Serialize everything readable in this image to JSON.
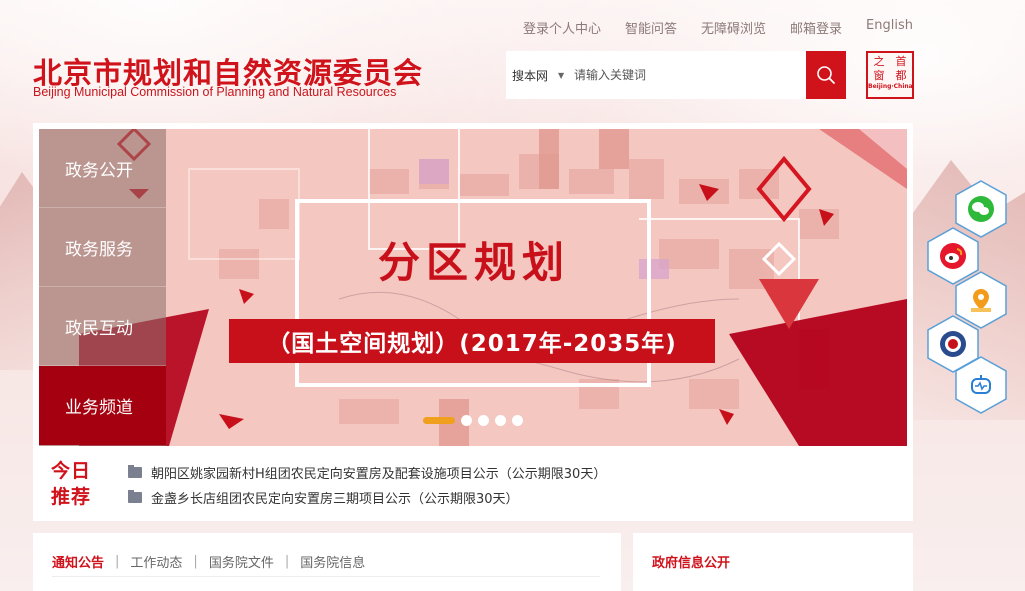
{
  "top_links": [
    "登录个人中心",
    "智能问答",
    "无障碍浏览",
    "邮箱登录",
    "English"
  ],
  "logo": {
    "cn": "北京市规划和自然资源委员会",
    "en": "Beijing Municipal Commission of Planning and Natural Resources"
  },
  "search": {
    "scope": "搜本网",
    "placeholder": "请输入关键词"
  },
  "seal": {
    "chars": [
      "首",
      "都",
      "之",
      "窗"
    ],
    "en": "Beijing·China"
  },
  "nav": {
    "items": [
      {
        "label": "政务公开"
      },
      {
        "label": "政务服务"
      },
      {
        "label": "政民互动"
      },
      {
        "label": "业务频道"
      }
    ]
  },
  "banner": {
    "title": "分区规划",
    "subtitle": "（国土空间规划）(2017年-2035年)",
    "slide_count": 5,
    "active_slide": 0
  },
  "today": {
    "label_line1": "今日",
    "label_line2": "推荐",
    "items": [
      "朝阳区姚家园新村H组团农民定向安置房及配套设施项目公示（公示期限30天）",
      "金盏乡长店组团农民定向安置房三期项目公示（公示期限30天）"
    ]
  },
  "notice_tabs": [
    "通知公告",
    "工作动态",
    "国务院文件",
    "国务院信息"
  ],
  "gov_info": {
    "title": "政府信息公开"
  },
  "social": [
    "wechat-icon",
    "weibo-icon",
    "map-location-icon",
    "emblem-icon",
    "robot-icon"
  ],
  "colors": {
    "brand": "#d0121b",
    "accent_dot": "#f0a01d",
    "nav_active": "#a4000f"
  }
}
